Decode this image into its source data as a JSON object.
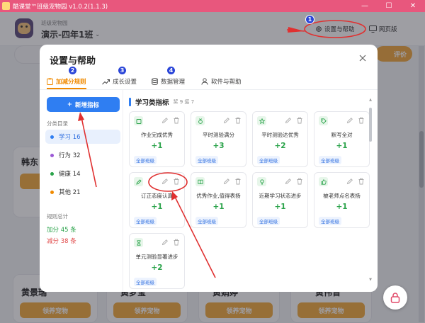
{
  "window": {
    "title": "酷课堂™班级宠物园 v1.0.2(1.1.3)",
    "minimize": "—",
    "maximize": "☐",
    "close": "✕"
  },
  "header": {
    "subtitle": "班级宠物园",
    "class_name": "演示-四年1班",
    "settings_label": "设置与帮助",
    "web_label": "网页版",
    "right_pill": "评价"
  },
  "background": {
    "pet_names": [
      "韩东",
      "黄景瑞",
      "黄梦莹",
      "黄娟婷",
      "黄伟晋"
    ],
    "adopt_label": "领养宠物"
  },
  "modal": {
    "title": "设置与帮助",
    "tabs": [
      {
        "label": "加减分规则",
        "active": true
      },
      {
        "label": "成长设置",
        "active": false
      },
      {
        "label": "数据管理",
        "active": false
      },
      {
        "label": "软件与帮助",
        "active": false
      }
    ],
    "add_button": "新增指标",
    "categories_title": "分类目录",
    "categories": [
      {
        "label": "学习 16",
        "color": "#2f7ef2",
        "active": true
      },
      {
        "label": "行为 32",
        "color": "#9b59d6",
        "active": false
      },
      {
        "label": "健康 14",
        "color": "#2aa34a",
        "active": false
      },
      {
        "label": "其他 21",
        "color": "#f08a00",
        "active": false
      }
    ],
    "stats_title": "规则总计",
    "stats": [
      {
        "label": "加分 45 条",
        "color": "#2aa34a"
      },
      {
        "label": "减分 38 条",
        "color": "#e14b4b"
      }
    ],
    "section_title": "学习类指标",
    "section_count": "奖 9 惩 7",
    "rules": [
      {
        "name": "作业完成优秀",
        "points": "+1",
        "scope": "全部班级",
        "icon": "clipboard-icon"
      },
      {
        "name": "平时测验满分",
        "points": "+3",
        "scope": "全部班级",
        "icon": "medal-icon"
      },
      {
        "name": "平时测验达优秀",
        "points": "+2",
        "scope": "全部班级",
        "icon": "star-icon"
      },
      {
        "name": "默写全对",
        "points": "+1",
        "scope": "全部班级",
        "icon": "tag-icon"
      },
      {
        "name": "订正态度认真",
        "points": "+1",
        "scope": "全部班级",
        "icon": "pencil-icon"
      },
      {
        "name": "优秀作业,值得表扬",
        "points": "+1",
        "scope": "全部班级",
        "icon": "book-icon"
      },
      {
        "name": "近期学习状态进步",
        "points": "+1",
        "scope": "全部班级",
        "icon": "bulb-icon"
      },
      {
        "name": "被老师点名表扬",
        "points": "+1",
        "scope": "全部班级",
        "icon": "thumbs-up-icon"
      },
      {
        "name": "单元测验显著进步",
        "points": "+2",
        "scope": "全部班级",
        "icon": "hourglass-icon"
      }
    ]
  },
  "annotations": [
    "1",
    "2",
    "3",
    "4"
  ],
  "colors": {
    "titlebar": "#e8577d",
    "accent": "#f08a00",
    "primary": "#2f7ef2",
    "plus": "#2aa34a",
    "minus": "#e14b4b",
    "annotation": "#e03030",
    "badge": "#2a45d8"
  }
}
